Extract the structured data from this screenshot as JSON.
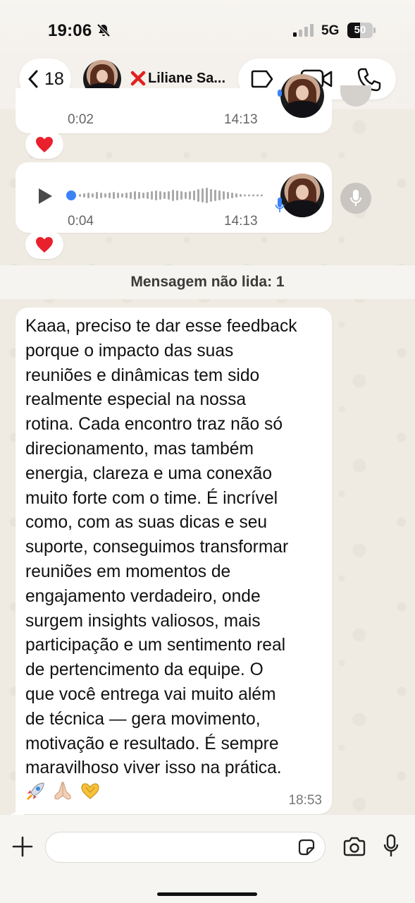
{
  "status_bar": {
    "time": "19:06",
    "network": "5G",
    "battery_level": "50",
    "battery_fraction": 0.5
  },
  "header": {
    "back_count": "18",
    "contact_name": "Liliane Sa...",
    "contact_prefix_icon": "red-x",
    "actions": [
      "label-icon",
      "video-call-icon",
      "phone-call-icon"
    ]
  },
  "messages": {
    "voice_1": {
      "duration": "0:02",
      "time": "14:13",
      "reaction": "heart"
    },
    "voice_2": {
      "duration": "0:04",
      "time": "14:13",
      "progress": 0,
      "reaction": "heart"
    },
    "unread_banner": "Mensagem não lida: 1",
    "text_message": {
      "body": "Kaaa, preciso te dar esse feedback\nporque o impacto das suas\nreuniões e dinâmicas tem sido\nrealmente especial na nossa\nrotina. Cada encontro traz não só\ndirecionamento, mas também\nenergia, clareza e uma conexão\nmuito forte com o time. É incrível\ncomo, com as suas dicas e seu\nsuporte, conseguimos transformar\nreuniões em momentos de\nengajamento verdadeiro, onde\nsurgem insights valiosos, mais\nparticipação e um sentimento real\nde pertencimento da equipe. O\nque você entrega vai muito além\nde técnica — gera movimento,\nmotivação e resultado. É sempre\nmaravilhoso viver isso na prática.",
      "emojis": [
        "rocket",
        "folded-hands",
        "heart-hands"
      ],
      "time": "18:53"
    }
  },
  "input_bar": {
    "value": "",
    "placeholder": ""
  },
  "colors": {
    "wallpaper": "#efeae2",
    "bubble": "#ffffff",
    "heart": "#e8212d",
    "mic_blue": "#3b82f6",
    "play_dot": "#3b82f6"
  }
}
